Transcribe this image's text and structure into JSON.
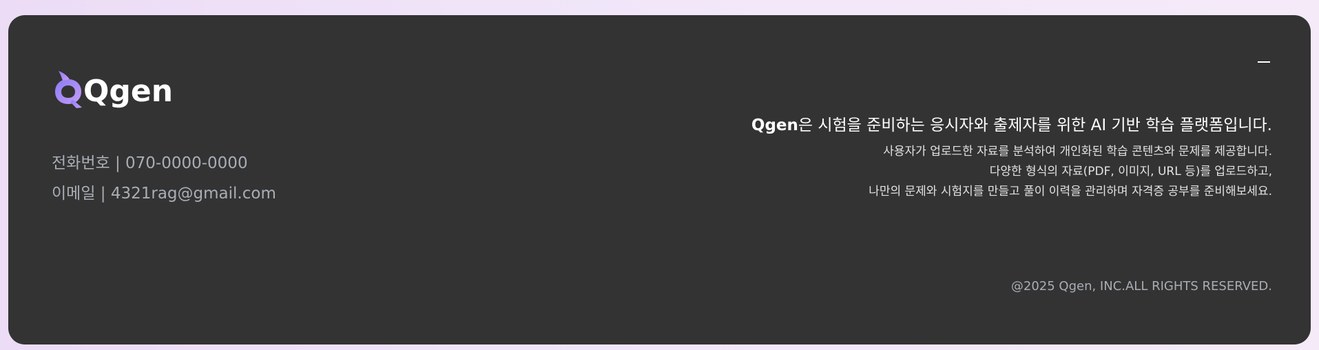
{
  "brand": {
    "name": "Qgen",
    "logo_icon": "dolphin-q-logo-icon",
    "logo_gradient": [
      "#8b7cf6",
      "#c59cf7"
    ]
  },
  "contact": {
    "phone": "전화번호 | 070-0000-0000",
    "email": "이메일 | 4321rag@gmail.com"
  },
  "window": {
    "minimize_icon": "minimize-icon"
  },
  "intro": {
    "headline_brand": "Qgen",
    "headline_rest": "은 시험을 준비하는 응시자와 출제자를 위한 AI 기반 학습 플랫폼입니다.",
    "lines": [
      "사용자가 업로드한 자료를 분석하여 개인화된 학습 콘텐츠와 문제를 제공합니다.",
      "다양한 형식의 자료(PDF, 이미지, URL 등)를 업로드하고,",
      "나만의 문제와 시험지를 만들고 풀이 이력을 관리하며 자격증 공부를 준비해보세요."
    ]
  },
  "copyright": "@2025 Qgen, INC.ALL RIGHTS RESERVED.",
  "colors": {
    "footer_bg": "#333333",
    "muted_text": "#a9adb5",
    "white": "#ffffff"
  }
}
